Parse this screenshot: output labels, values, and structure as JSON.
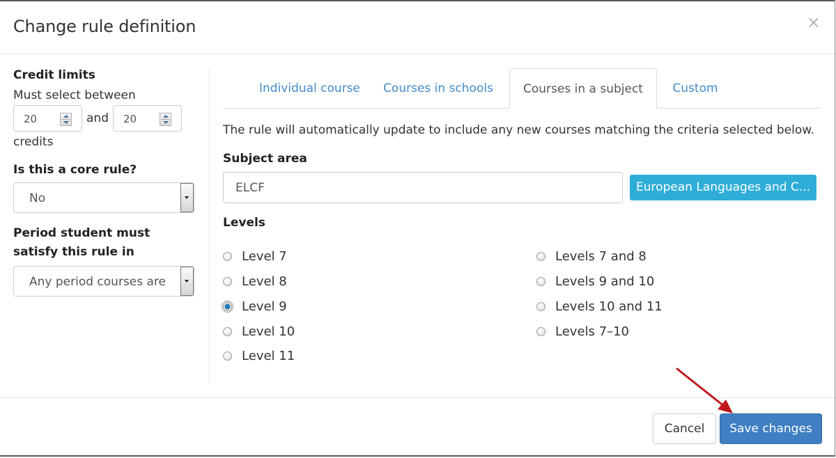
{
  "dialog": {
    "title": "Change rule definition",
    "close_icon": "close-icon"
  },
  "left": {
    "credit_limits": {
      "heading": "Credit limits",
      "intro": "Must select between",
      "min_value": "20",
      "and_label": "and",
      "max_value": "20",
      "suffix": "credits"
    },
    "core_rule": {
      "label": "Is this a core rule?",
      "selected": "No"
    },
    "period": {
      "label": "Period student must satisfy this rule in",
      "selected": "Any period courses are"
    }
  },
  "tabs": [
    {
      "label": "Individual course",
      "active": false
    },
    {
      "label": "Courses in schools",
      "active": false
    },
    {
      "label": "Courses in a subject",
      "active": true
    },
    {
      "label": "Custom",
      "active": false
    }
  ],
  "subject_tab": {
    "info": "The rule will automatically update to include any new courses matching the criteria selected below.",
    "subject_area_label": "Subject area",
    "subject_area_value": "ELCF",
    "subject_button_label": "European Languages and C...",
    "levels_label": "Levels",
    "levels_left": [
      {
        "label": "Level 7",
        "checked": false
      },
      {
        "label": "Level 8",
        "checked": false
      },
      {
        "label": "Level 9",
        "checked": true
      },
      {
        "label": "Level 10",
        "checked": false
      },
      {
        "label": "Level 11",
        "checked": false
      }
    ],
    "levels_right": [
      {
        "label": "Levels 7 and 8",
        "checked": false
      },
      {
        "label": "Levels 9 and 10",
        "checked": false
      },
      {
        "label": "Levels 10 and 11",
        "checked": false
      },
      {
        "label": "Levels 7–10",
        "checked": false
      }
    ]
  },
  "footer": {
    "cancel_label": "Cancel",
    "save_label": "Save changes"
  },
  "colors": {
    "link": "#428bca",
    "info_button": "#2fadd9",
    "primary_button": "#3f7fc2",
    "annotation_arrow": "#c0161c"
  }
}
